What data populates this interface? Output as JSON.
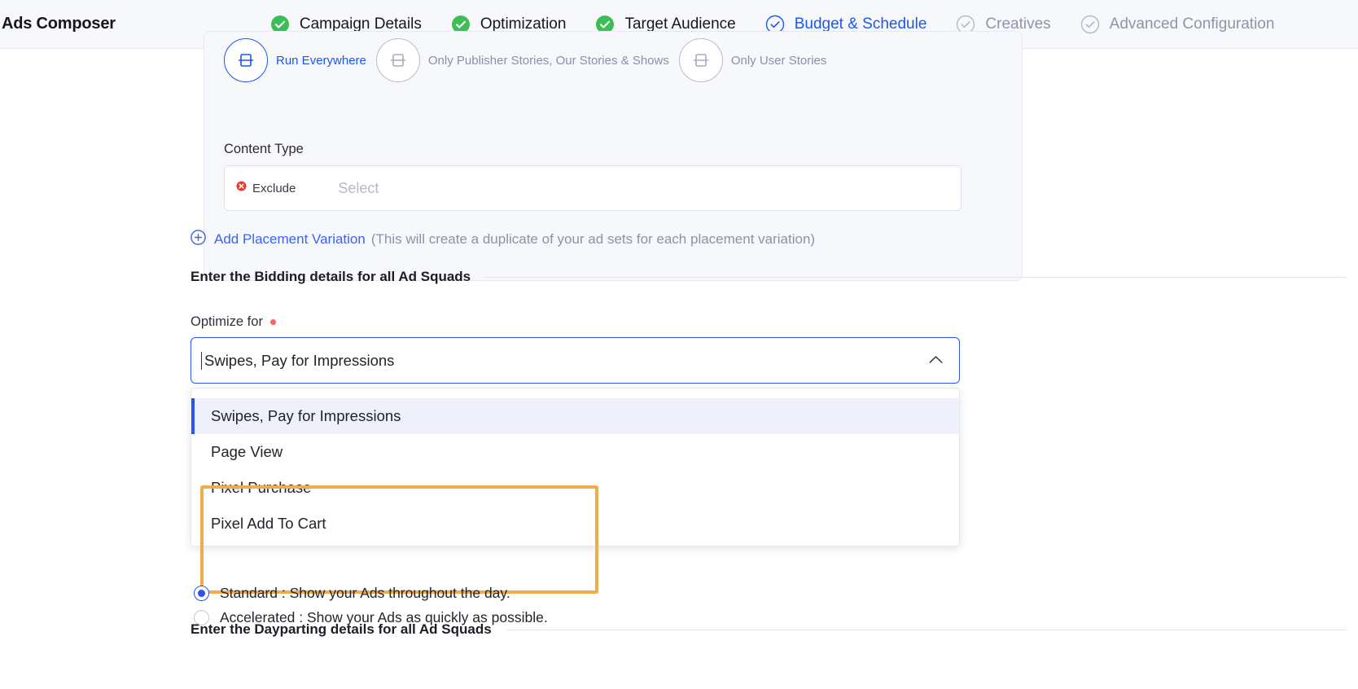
{
  "header": {
    "app_title": "Ads Composer",
    "steps": [
      {
        "label": "Campaign Details",
        "state": "complete",
        "icon": "check-circle-filled-icon"
      },
      {
        "label": "Optimization",
        "state": "complete",
        "icon": "check-circle-filled-icon"
      },
      {
        "label": "Target Audience",
        "state": "complete",
        "icon": "check-circle-filled-icon"
      },
      {
        "label": "Budget & Schedule",
        "state": "active",
        "icon": "check-circle-outline-icon"
      },
      {
        "label": "Creatives",
        "state": "upcoming",
        "icon": "check-circle-outline-icon"
      },
      {
        "label": "Advanced Configuration",
        "state": "upcoming",
        "icon": "check-circle-outline-icon"
      }
    ],
    "colors": {
      "active": "#1a56f0",
      "complete": "#3bbf55",
      "muted": "#9094a6",
      "underline": "#1a3fd8"
    }
  },
  "placement_card": {
    "options": [
      {
        "label": "Run Everywhere",
        "selected": true,
        "icon": "phone-frame-icon"
      },
      {
        "label": "Only Publisher Stories, Our Stories & Shows",
        "selected": false,
        "icon": "phone-frame-icon"
      },
      {
        "label": "Only User Stories",
        "selected": false,
        "icon": "phone-frame-icon"
      }
    ],
    "content_type": {
      "label": "Content Type",
      "exclude_label": "Exclude",
      "exclude_icon": "exclude-pin-icon",
      "placeholder": "Select",
      "value": ""
    }
  },
  "add_variation": {
    "icon": "plus-circle-icon",
    "link_label": "Add Placement Variation",
    "hint": "(This will create a duplicate of your ad sets for each placement variation)"
  },
  "bidding_section": {
    "heading": "Enter the Bidding details for all Ad Squads",
    "optimize_for": {
      "label": "Optimize for",
      "required": true,
      "value": "Swipes, Pay for Impressions",
      "chevron_icon": "chevron-up-icon",
      "expanded": true,
      "options": [
        {
          "label": "Swipes, Pay for Impressions",
          "selected": true
        },
        {
          "label": "Page View",
          "selected": false
        },
        {
          "label": "Pixel Purchase",
          "selected": false
        },
        {
          "label": "Pixel Add To Cart",
          "selected": false
        }
      ]
    },
    "delivery_radios": [
      {
        "label": "Standard : Show your Ads throughout the day.",
        "selected": true
      },
      {
        "label": "Accelerated : Show your Ads as quickly as possible.",
        "selected": false
      }
    ]
  },
  "dayparting_section": {
    "heading": "Enter the Dayparting details for all Ad Squads"
  },
  "annotation": {
    "type": "highlight-rectangle",
    "color": "#eeac4b",
    "covers": [
      "Page View",
      "Pixel Purchase",
      "Pixel Add To Cart"
    ]
  }
}
